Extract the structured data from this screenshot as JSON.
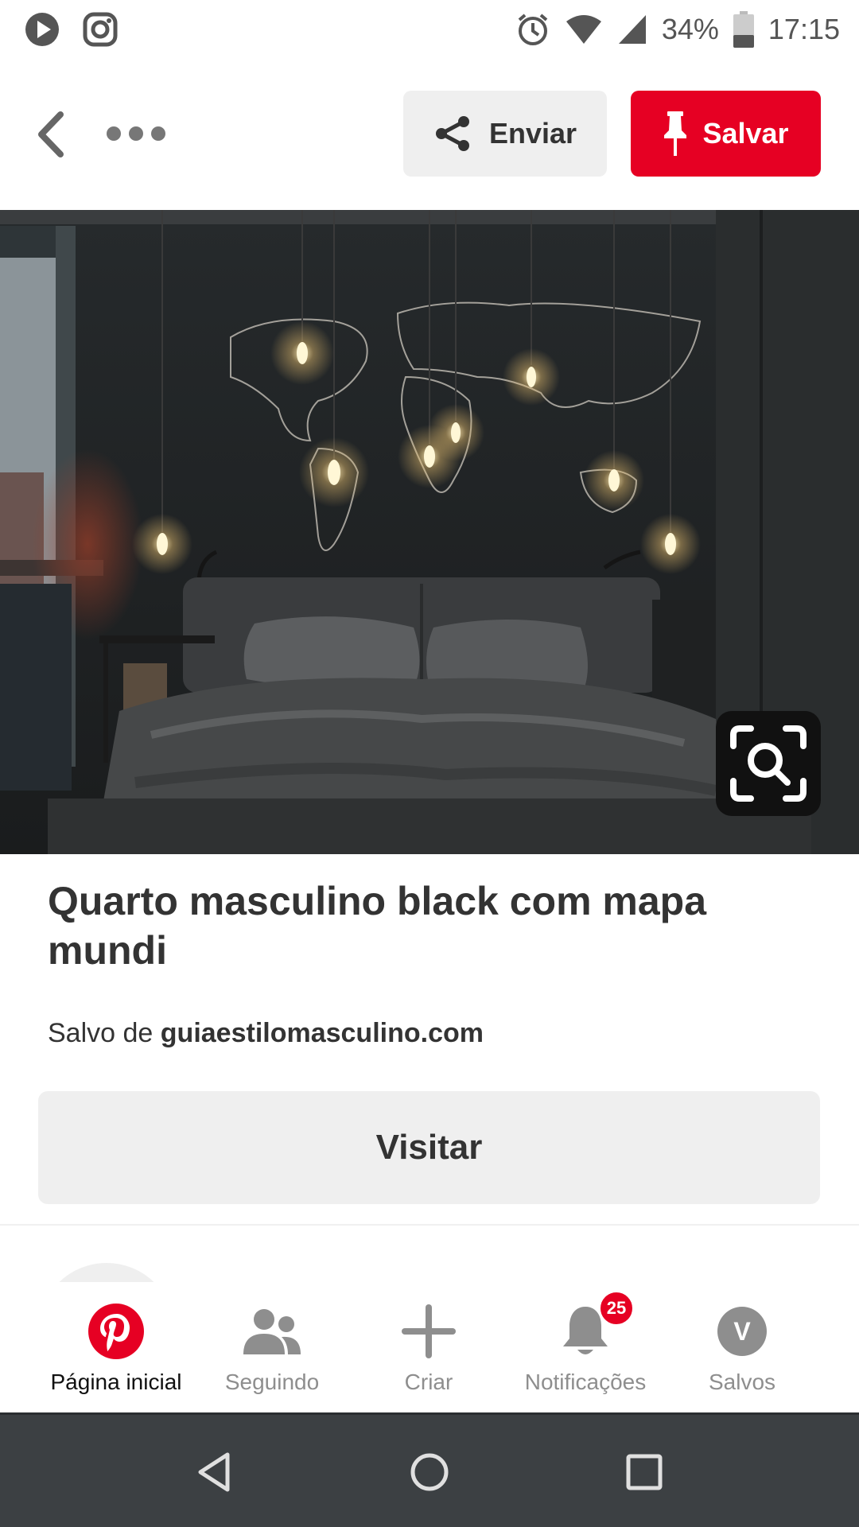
{
  "status_bar": {
    "battery": "34%",
    "time": "17:15",
    "icons": [
      "play-icon",
      "instagram-icon",
      "alarm-icon",
      "wifi-icon",
      "signal-icon",
      "battery-icon"
    ]
  },
  "header": {
    "send_label": "Enviar",
    "save_label": "Salvar",
    "icons": [
      "back-icon",
      "more-icon",
      "share-icon",
      "pin-icon"
    ]
  },
  "pin": {
    "title": "Quarto masculino black com mapa mundi",
    "saved_from_prefix": "Salvo de",
    "saved_from_domain": "guiaestilomasculino.com",
    "visit_label": "Visitar"
  },
  "bottom_nav": {
    "items": [
      {
        "label": "Página inicial",
        "icon": "pinterest-icon",
        "active": true
      },
      {
        "label": "Seguindo",
        "icon": "people-icon",
        "active": false
      },
      {
        "label": "Criar",
        "icon": "plus-icon",
        "active": false
      },
      {
        "label": "Notificações",
        "icon": "bell-icon",
        "active": false,
        "badge": "25"
      },
      {
        "label": "Salvos",
        "icon": "avatar",
        "active": false,
        "avatar_letter": "V"
      }
    ]
  },
  "colors": {
    "brand_red": "#e60023",
    "button_gray": "#efefef",
    "text_dark": "#333333",
    "nav_inactive": "#8e8e8e",
    "system_nav": "#3c4043"
  }
}
